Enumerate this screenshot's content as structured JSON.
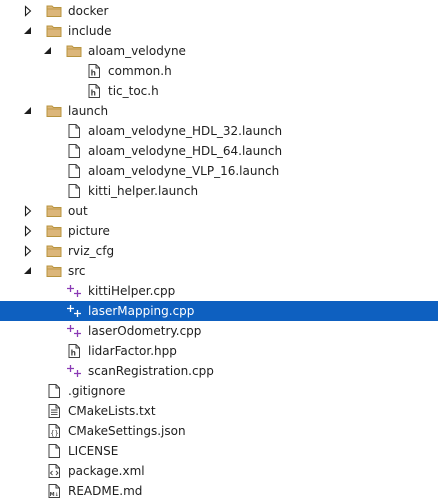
{
  "colors": {
    "folder_fill": "#dcb67a",
    "folder_edge": "#b8943f",
    "selection": "#0e60c0",
    "cpp_plus": "#8a3bb5",
    "arrow": "#1e1e1e"
  },
  "tree": [
    {
      "name": "docker",
      "kind": "folder",
      "depth": 0,
      "expanded": false
    },
    {
      "name": "include",
      "kind": "folder",
      "depth": 0,
      "expanded": true
    },
    {
      "name": "aloam_velodyne",
      "kind": "folder",
      "depth": 1,
      "expanded": true
    },
    {
      "name": "common.h",
      "kind": "header",
      "depth": 2
    },
    {
      "name": "tic_toc.h",
      "kind": "header",
      "depth": 2
    },
    {
      "name": "launch",
      "kind": "folder",
      "depth": 0,
      "expanded": true
    },
    {
      "name": "aloam_velodyne_HDL_32.launch",
      "kind": "file",
      "depth": 1
    },
    {
      "name": "aloam_velodyne_HDL_64.launch",
      "kind": "file",
      "depth": 1
    },
    {
      "name": "aloam_velodyne_VLP_16.launch",
      "kind": "file",
      "depth": 1
    },
    {
      "name": "kitti_helper.launch",
      "kind": "file",
      "depth": 1
    },
    {
      "name": "out",
      "kind": "folder",
      "depth": 0,
      "expanded": false
    },
    {
      "name": "picture",
      "kind": "folder",
      "depth": 0,
      "expanded": false
    },
    {
      "name": "rviz_cfg",
      "kind": "folder",
      "depth": 0,
      "expanded": false
    },
    {
      "name": "src",
      "kind": "folder",
      "depth": 0,
      "expanded": true
    },
    {
      "name": "kittiHelper.cpp",
      "kind": "cpp",
      "depth": 1
    },
    {
      "name": "laserMapping.cpp",
      "kind": "cpp",
      "depth": 1,
      "selected": true
    },
    {
      "name": "laserOdometry.cpp",
      "kind": "cpp",
      "depth": 1
    },
    {
      "name": "lidarFactor.hpp",
      "kind": "header",
      "depth": 1
    },
    {
      "name": "scanRegistration.cpp",
      "kind": "cpp",
      "depth": 1
    },
    {
      "name": ".gitignore",
      "kind": "file",
      "depth": 0
    },
    {
      "name": "CMakeLists.txt",
      "kind": "text",
      "depth": 0
    },
    {
      "name": "CMakeSettings.json",
      "kind": "json",
      "depth": 0
    },
    {
      "name": "LICENSE",
      "kind": "file",
      "depth": 0
    },
    {
      "name": "package.xml",
      "kind": "xml",
      "depth": 0
    },
    {
      "name": "README.md",
      "kind": "markdown",
      "depth": 0
    }
  ]
}
